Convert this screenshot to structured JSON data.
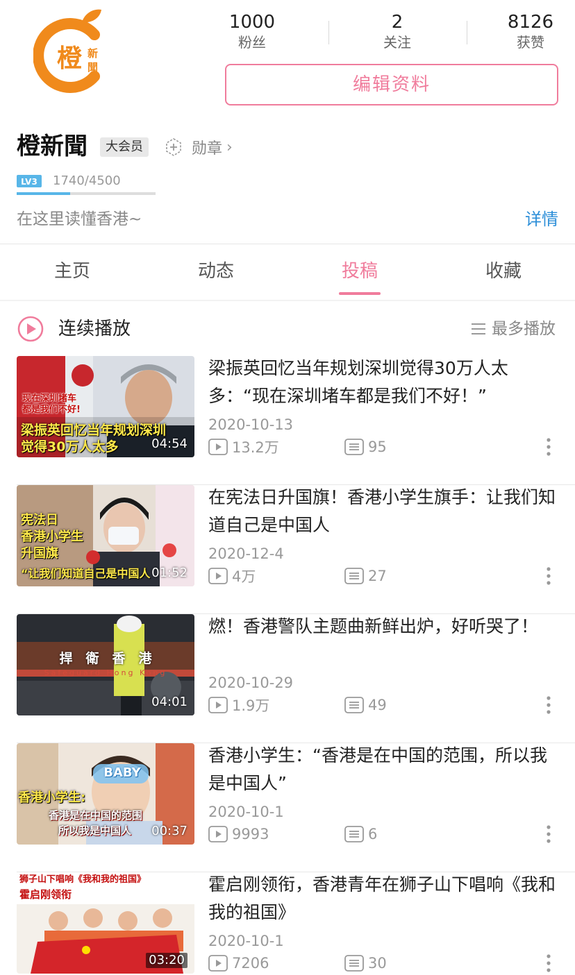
{
  "brand": {
    "logo_char": "橙",
    "logo_small_1": "新",
    "logo_small_2": "聞",
    "orange": "#f08a1c"
  },
  "profile": {
    "stats": [
      {
        "value": "1000",
        "label": "粉丝"
      },
      {
        "value": "2",
        "label": "关注"
      },
      {
        "value": "8126",
        "label": "获赞"
      }
    ],
    "edit_button": "编辑资料",
    "name": "橙新聞",
    "vip_badge": "大会员",
    "medal_label": "勋章",
    "level_badge": "LV3",
    "exp_text": "1740/4500",
    "exp_progress": 0.387,
    "bio": "在这里读懂香港~",
    "detail_link": "详情"
  },
  "tabs": [
    {
      "label": "主页",
      "active": false
    },
    {
      "label": "动态",
      "active": false
    },
    {
      "label": "投稿",
      "active": true
    },
    {
      "label": "收藏",
      "active": false
    }
  ],
  "playbar": {
    "label": "连续播放",
    "sort_label": "最多播放",
    "icon": "play-circle-icon",
    "sort_icon": "list-icon"
  },
  "accent_color": "#f07c9c",
  "link_color": "#2b8ed8",
  "videos": [
    {
      "title": "梁振英回忆当年规划深圳觉得30万人太多：“现在深圳堵车都是我们不好！”",
      "date": "2020-10-13",
      "views": "13.2万",
      "comments": "95",
      "duration": "04:54",
      "thumb_caption_1": "现在深圳堵车",
      "thumb_caption_2": "都是我们不好!",
      "thumb_caption_3": "梁振英回忆当年规划深圳",
      "thumb_caption_4": "觉得30万人太多"
    },
    {
      "title": "在宪法日升国旗！香港小学生旗手：让我们知道自己是中国人",
      "date": "2020-12-4",
      "views": "4万",
      "comments": "27",
      "duration": "01:52",
      "thumb_caption_1": "宪法日",
      "thumb_caption_2": "香港小学生",
      "thumb_caption_3": "升国旗",
      "thumb_caption_4": "“让我们知道自己是中国人"
    },
    {
      "title": "燃！香港警队主题曲新鲜出炉，好听哭了！",
      "date": "2020-10-29",
      "views": "1.9万",
      "comments": "49",
      "duration": "04:01",
      "thumb_caption_1": "捍　衛　香　港",
      "thumb_caption_2": "Safeguard Hong Kong"
    },
    {
      "title": "香港小学生：“香港是在中国的范围，所以我是中国人”",
      "date": "2020-10-1",
      "views": "9993",
      "comments": "6",
      "duration": "00:37",
      "thumb_caption_1": "BABY",
      "thumb_caption_2": "香港小学生:",
      "thumb_caption_3": "香港是在中国的范围",
      "thumb_caption_4": "所以我是中国人"
    },
    {
      "title": "霍启刚领衔，香港青年在狮子山下唱响《我和我的祖国》",
      "date": "2020-10-1",
      "views": "7206",
      "comments": "30",
      "duration": "03:20",
      "thumb_caption_1": "狮子山下唱响《我和我的祖国》",
      "thumb_caption_2": "霍启刚领衔"
    }
  ]
}
